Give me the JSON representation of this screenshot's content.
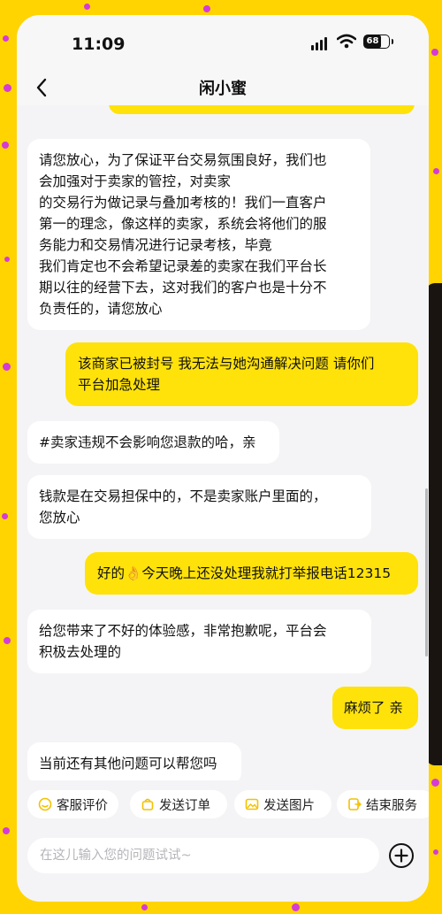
{
  "colors": {
    "background_yellow": "#FFD400",
    "confetti_purple": "#D43BD6",
    "out_bubble": "#FFE20A",
    "in_bubble": "#FFFFFF",
    "chip_icon": "#F2C200"
  },
  "status_bar": {
    "time": "11:09",
    "battery_level": "68",
    "icons": [
      "signal-icon",
      "wifi-icon",
      "battery-icon"
    ]
  },
  "header": {
    "back_icon": "chevron-left-icon",
    "title": "闲小蜜"
  },
  "messages": [
    {
      "side": "in",
      "lines": [
        "请您放心，为了保证平台交易氛围良好，我们也",
        "会加强对于卖家的管控，对卖家",
        "的交易行为做记录与叠加考核的！我们一直客户",
        "第一的理念，像这样的卖家，系统会将他们的服",
        "务能力和交易情况进行记录考核，毕竟",
        "我们肯定也不会希望记录差的卖家在我们平台长",
        "期以往的经营下去，这对我们的客户也是十分不",
        "负责任的，请您放心"
      ]
    },
    {
      "side": "out",
      "lines": [
        "该商家已被封号 我无法与她沟通解决问题 请你们",
        "平台加急处理"
      ]
    },
    {
      "side": "in",
      "lines": [
        "#卖家违规不会影响您退款的哈，亲"
      ]
    },
    {
      "side": "in",
      "lines": [
        "钱款是在交易担保中的，不是卖家账户里面的，",
        "您放心"
      ]
    },
    {
      "side": "out",
      "lines": [
        "好的👌今天晚上还没处理我就打举报电话12315"
      ]
    },
    {
      "side": "in",
      "lines": [
        "给您带来了不好的体验感，非常抱歉呢，平台会",
        "积极去处理的"
      ]
    },
    {
      "side": "out",
      "lines": [
        "麻烦了 亲"
      ]
    },
    {
      "side": "in",
      "lines": [
        "当前还有其他问题可以帮您吗"
      ]
    }
  ],
  "quick_actions": [
    {
      "label": "客服评价",
      "icon": "smile-icon"
    },
    {
      "label": "发送订单",
      "icon": "bag-icon"
    },
    {
      "label": "发送图片",
      "icon": "image-icon"
    },
    {
      "label": "结束服务",
      "icon": "exit-icon"
    }
  ],
  "input": {
    "placeholder": "在这儿输入您的问题试试~",
    "value": "",
    "plus_icon": "plus-circle-icon"
  }
}
